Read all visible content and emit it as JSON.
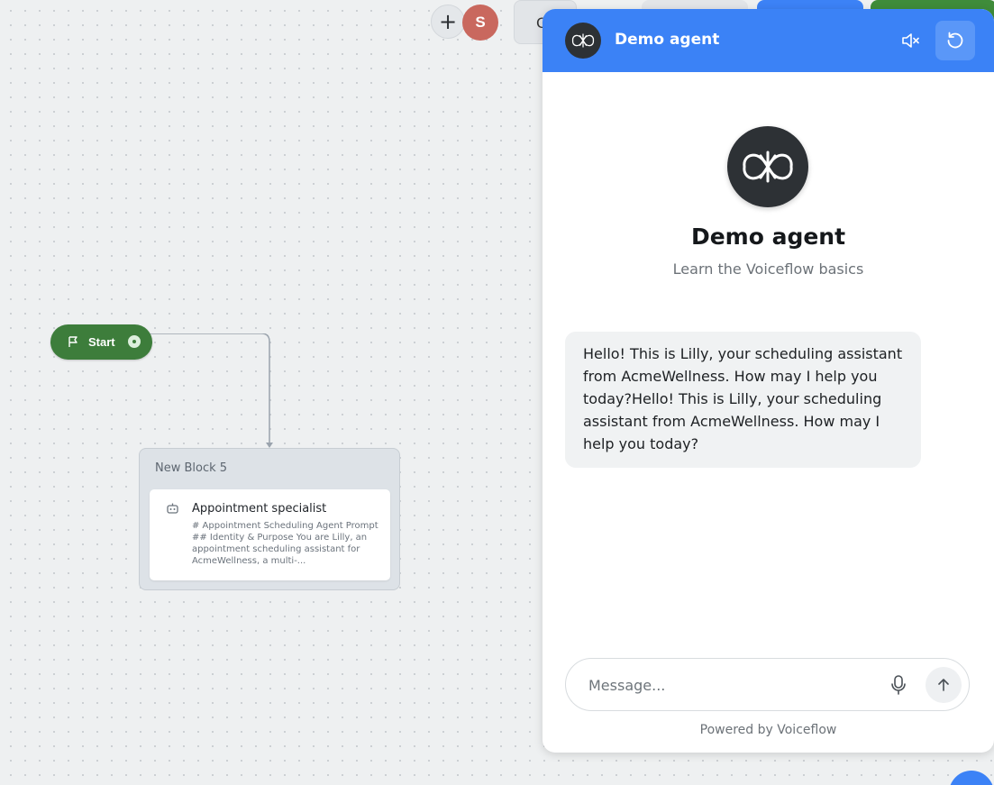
{
  "toolbar": {
    "add_symbol": "+",
    "user_initial": "S",
    "button_partial": "G"
  },
  "flow": {
    "start_label": "Start",
    "block": {
      "title": "New Block 5",
      "card_title": "Appointment specialist",
      "card_description": "# Appointment Scheduling Agent Prompt ## Identity & Purpose You are Lilly, an appointment scheduling assistant for AcmeWellness, a multi-..."
    }
  },
  "chat": {
    "header_title": "Demo agent",
    "agent_name": "Demo agent",
    "agent_subtitle": "Learn the Voiceflow basics",
    "messages": [
      {
        "role": "assistant",
        "text": "Hello! This is Lilly, your scheduling assistant from AcmeWellness. How may I help you today?Hello! This is Lilly, your scheduling assistant from AcmeWellness. How may I help you today?"
      }
    ],
    "input_placeholder": "Message...",
    "powered_by": "Powered by Voiceflow"
  },
  "colors": {
    "header_blue": "#3b82f6",
    "start_green": "#3d7d3b",
    "avatar_red": "#c9685e",
    "agent_avatar_dark": "#2d3135"
  },
  "icons": {
    "mute": "speaker-muted-icon",
    "reset": "refresh-icon",
    "mic": "microphone-icon",
    "send": "arrow-up-icon",
    "agent_logo": "voiceflow-logo-icon",
    "card": "robot-icon",
    "start": "flag-icon"
  }
}
